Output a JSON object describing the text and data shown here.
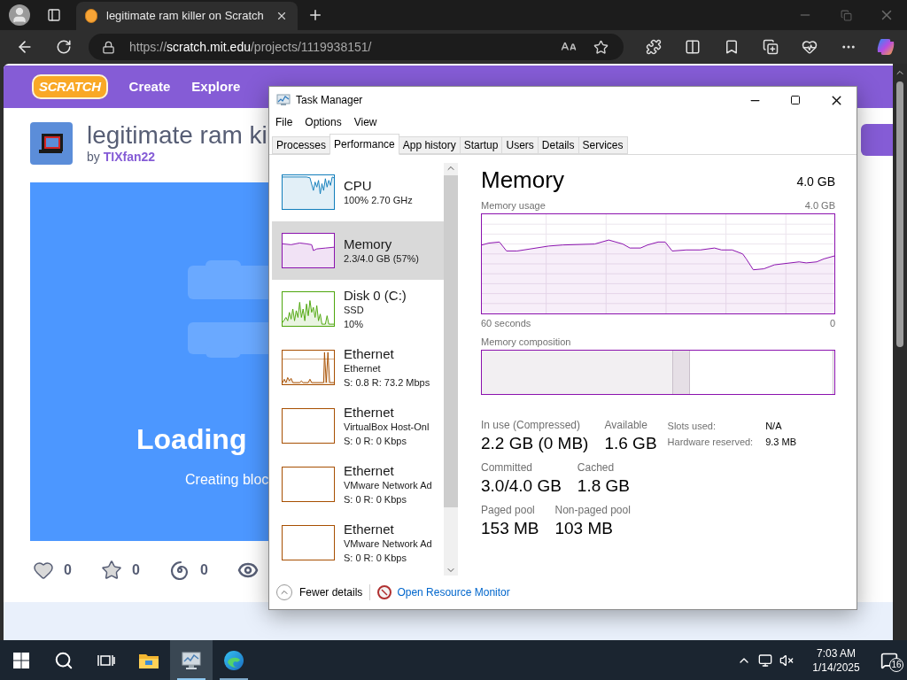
{
  "browser": {
    "tab_title": "legitimate ram killer on Scratch",
    "url": "https://**scratch.mit.edu**/projects/1119938151/"
  },
  "scratch": {
    "logo": "SCRATCH",
    "nav": [
      "Create",
      "Explore"
    ],
    "project_title": "legitimate ram ki",
    "by": "by",
    "author": "TIXfan22",
    "loading": "Loading",
    "loading_detail": "Creating bloc",
    "stats": [
      {
        "kind": "love",
        "count": "0"
      },
      {
        "kind": "favorite",
        "count": "0"
      },
      {
        "kind": "remix",
        "count": "0"
      },
      {
        "kind": "views"
      }
    ]
  },
  "task_manager": {
    "title": "Task Manager",
    "menu": [
      "File",
      "Options",
      "View"
    ],
    "tabs": [
      {
        "label": "Processes",
        "selected": false
      },
      {
        "label": "Performance",
        "selected": true
      },
      {
        "label": "App history",
        "selected": false
      },
      {
        "label": "Startup",
        "selected": false
      },
      {
        "label": "Users",
        "selected": false
      },
      {
        "label": "Details",
        "selected": false
      },
      {
        "label": "Services",
        "selected": false
      }
    ],
    "perf_items": [
      {
        "title": "CPU",
        "lines": [
          "100% 2.70 GHz"
        ],
        "color": "#117dbb",
        "selected": false
      },
      {
        "title": "Memory",
        "lines": [
          "2.3/4.0 GB (57%)"
        ],
        "color": "#8b12ae",
        "selected": true
      },
      {
        "title": "Disk 0 (C:)",
        "lines": [
          "SSD",
          "10%"
        ],
        "color": "#4da60c",
        "selected": false
      },
      {
        "title": "Ethernet",
        "lines": [
          "Ethernet",
          "S: 0.8 R: 73.2 Mbps"
        ],
        "color": "#a74f01",
        "selected": false
      },
      {
        "title": "Ethernet",
        "lines": [
          "VirtualBox Host-Onl",
          "S: 0 R: 0 Kbps"
        ],
        "color": "#a74f01",
        "selected": false
      },
      {
        "title": "Ethernet",
        "lines": [
          "VMware Network Ad",
          "S: 0 R: 0 Kbps"
        ],
        "color": "#a74f01",
        "selected": false
      },
      {
        "title": "Ethernet",
        "lines": [
          "VMware Network Ad",
          "S: 0 R: 0 Kbps"
        ],
        "color": "#a74f01",
        "selected": false
      }
    ],
    "detail": {
      "heading": "Memory",
      "total": "4.0 GB",
      "usage_label": "Memory usage",
      "usage_max": "4.0 GB",
      "time_label": "60 seconds",
      "time_end": "0",
      "composition_label": "Memory composition",
      "stat_rows": [
        [
          {
            "label": "In use (Compressed)",
            "value": "2.2 GB (0 MB)"
          },
          {
            "label": "Available",
            "value": "1.6 GB"
          }
        ],
        [
          {
            "label": "Committed",
            "value": "3.0/4.0 GB"
          },
          {
            "label": "Cached",
            "value": "1.8 GB"
          }
        ],
        [
          {
            "label": "Paged pool",
            "value": "153 MB"
          },
          {
            "label": "Non-paged pool",
            "value": "103 MB"
          }
        ]
      ],
      "side_stats": [
        {
          "label": "Slots used:",
          "value": "N/A"
        },
        {
          "label": "Hardware reserved:",
          "value": "9.3 MB"
        }
      ]
    },
    "footer": {
      "fewer": "Fewer details",
      "monitor": "Open Resource Monitor"
    }
  },
  "taskbar": {
    "apps": [
      {
        "kind": "start",
        "active": false,
        "running": false
      },
      {
        "kind": "search",
        "active": false,
        "running": false
      },
      {
        "kind": "task_view",
        "active": false,
        "running": false
      },
      {
        "kind": "explorer",
        "active": false,
        "running": false
      },
      {
        "kind": "task_manager",
        "active": true,
        "running": true
      },
      {
        "kind": "edge",
        "active": false,
        "running": true
      }
    ],
    "clock": {
      "time": "7:03 AM",
      "date": "1/14/2025"
    },
    "notifications": "16"
  }
}
